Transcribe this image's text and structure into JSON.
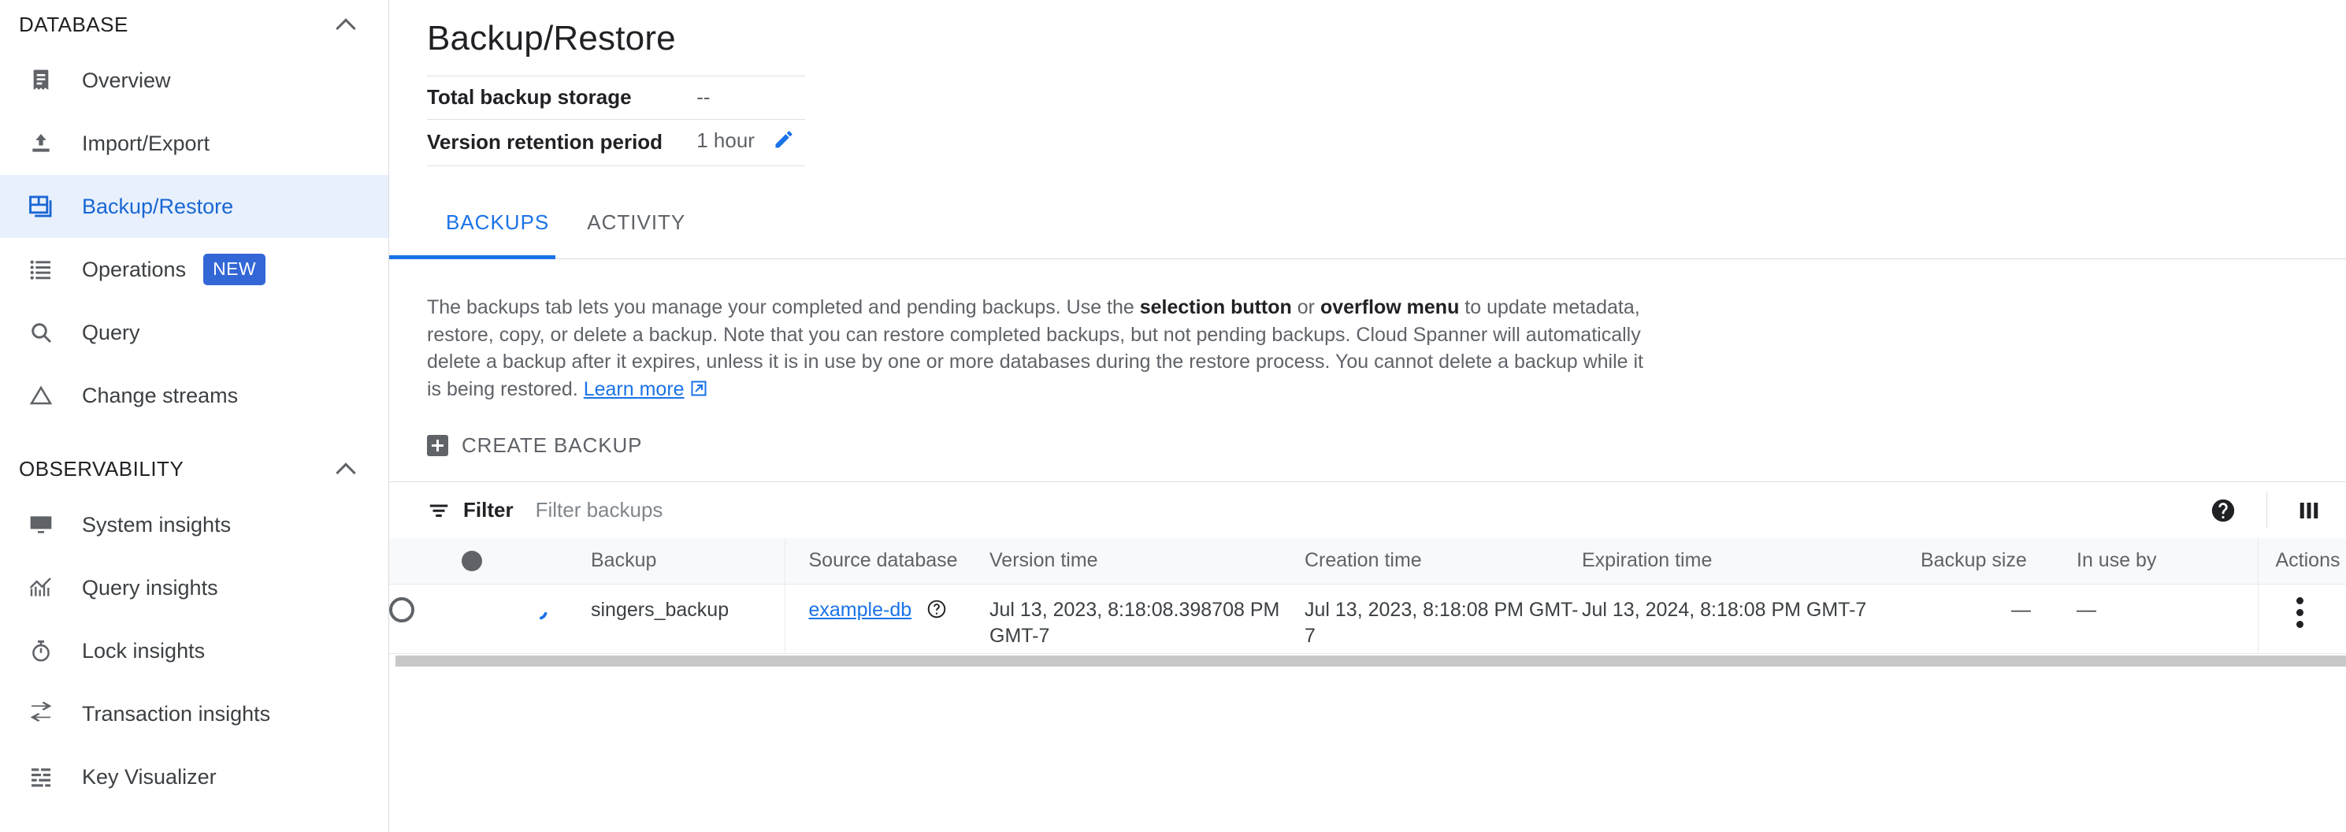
{
  "sidebar": {
    "groups": [
      {
        "title": "DATABASE",
        "collapse_icon": "chevron-up-icon",
        "items": [
          {
            "label": "Overview",
            "icon": "document-icon",
            "selected": false
          },
          {
            "label": "Import/Export",
            "icon": "upload-icon",
            "selected": false
          },
          {
            "label": "Backup/Restore",
            "icon": "backup-restore-icon",
            "selected": true
          },
          {
            "label": "Operations",
            "icon": "list-icon",
            "selected": false,
            "badge": "NEW"
          },
          {
            "label": "Query",
            "icon": "search-icon",
            "selected": false
          },
          {
            "label": "Change streams",
            "icon": "triangle-icon",
            "selected": false
          }
        ]
      },
      {
        "title": "OBSERVABILITY",
        "collapse_icon": "chevron-up-icon",
        "items": [
          {
            "label": "System insights",
            "icon": "monitoring-icon",
            "selected": false
          },
          {
            "label": "Query insights",
            "icon": "chart-up-icon",
            "selected": false
          },
          {
            "label": "Lock insights",
            "icon": "stopwatch-icon",
            "selected": false
          },
          {
            "label": "Transaction insights",
            "icon": "swap-arrows-icon",
            "selected": false
          },
          {
            "label": "Key Visualizer",
            "icon": "grid-dots-icon",
            "selected": false
          }
        ]
      }
    ]
  },
  "page": {
    "title": "Backup/Restore",
    "summary": [
      {
        "label": "Total backup storage",
        "value": "--",
        "editable": false
      },
      {
        "label": "Version retention period",
        "value": "1 hour",
        "editable": true,
        "edit_icon": "pencil-icon"
      }
    ]
  },
  "tabs": [
    {
      "label": "BACKUPS",
      "active": true
    },
    {
      "label": "ACTIVITY",
      "active": false
    }
  ],
  "description": {
    "part1": "The backups tab lets you manage your completed and pending backups. Use the ",
    "bold1": "selection button",
    "part2": " or ",
    "bold2": "overflow menu",
    "part3": " to update metadata, restore, copy, or delete a backup. Note that you can restore completed backups, but not pending backups. Cloud Spanner will automatically delete a backup after it expires, unless it is in use by one or more databases during the restore process. You cannot delete a backup while it is being restored. ",
    "link_label": "Learn more",
    "link_icon": "external-link-icon"
  },
  "toolbar": {
    "create_backup_label": "CREATE BACKUP",
    "create_icon": "plus-box-icon"
  },
  "filter": {
    "icon": "filter-icon",
    "label": "Filter",
    "placeholder": "Filter backups",
    "value": "",
    "help_icon": "help-circle-icon",
    "columns_icon": "column-settings-icon"
  },
  "table": {
    "columns": [
      {
        "key": "select",
        "label": ""
      },
      {
        "key": "status",
        "label": "",
        "icon": "status-dot-icon"
      },
      {
        "key": "progress",
        "label": ""
      },
      {
        "key": "backup",
        "label": "Backup"
      },
      {
        "key": "source_database",
        "label": "Source database"
      },
      {
        "key": "version_time",
        "label": "Version time"
      },
      {
        "key": "creation_time",
        "label": "Creation time"
      },
      {
        "key": "expiration_time",
        "label": "Expiration time"
      },
      {
        "key": "backup_size",
        "label": "Backup size"
      },
      {
        "key": "in_use_by",
        "label": "In use by"
      },
      {
        "key": "actions",
        "label": "Actions"
      }
    ],
    "rows": [
      {
        "select_icon": "radio-unchecked-icon",
        "progress_icon": "spinner-icon",
        "backup": "singers_backup",
        "source_database": "example-db",
        "source_database_help_icon": "help-circle-outline-icon",
        "version_time": "Jul 13, 2023, 8:18:08.398708 PM GMT-7",
        "creation_time": "Jul 13, 2023, 8:18:08 PM GMT-7",
        "expiration_time": "Jul 13, 2024, 8:18:08 PM GMT-7",
        "backup_size": "—",
        "in_use_by": "—",
        "actions_icon": "kebab-menu-icon"
      }
    ]
  },
  "colors": {
    "accent_blue": "#1a73e8",
    "selected_bg": "#e8f0fe",
    "badge_blue": "#3367d6",
    "text_primary": "#202124",
    "text_secondary": "#5f6368",
    "header_bg": "#f8f9fa",
    "border": "#e0e0e0"
  }
}
